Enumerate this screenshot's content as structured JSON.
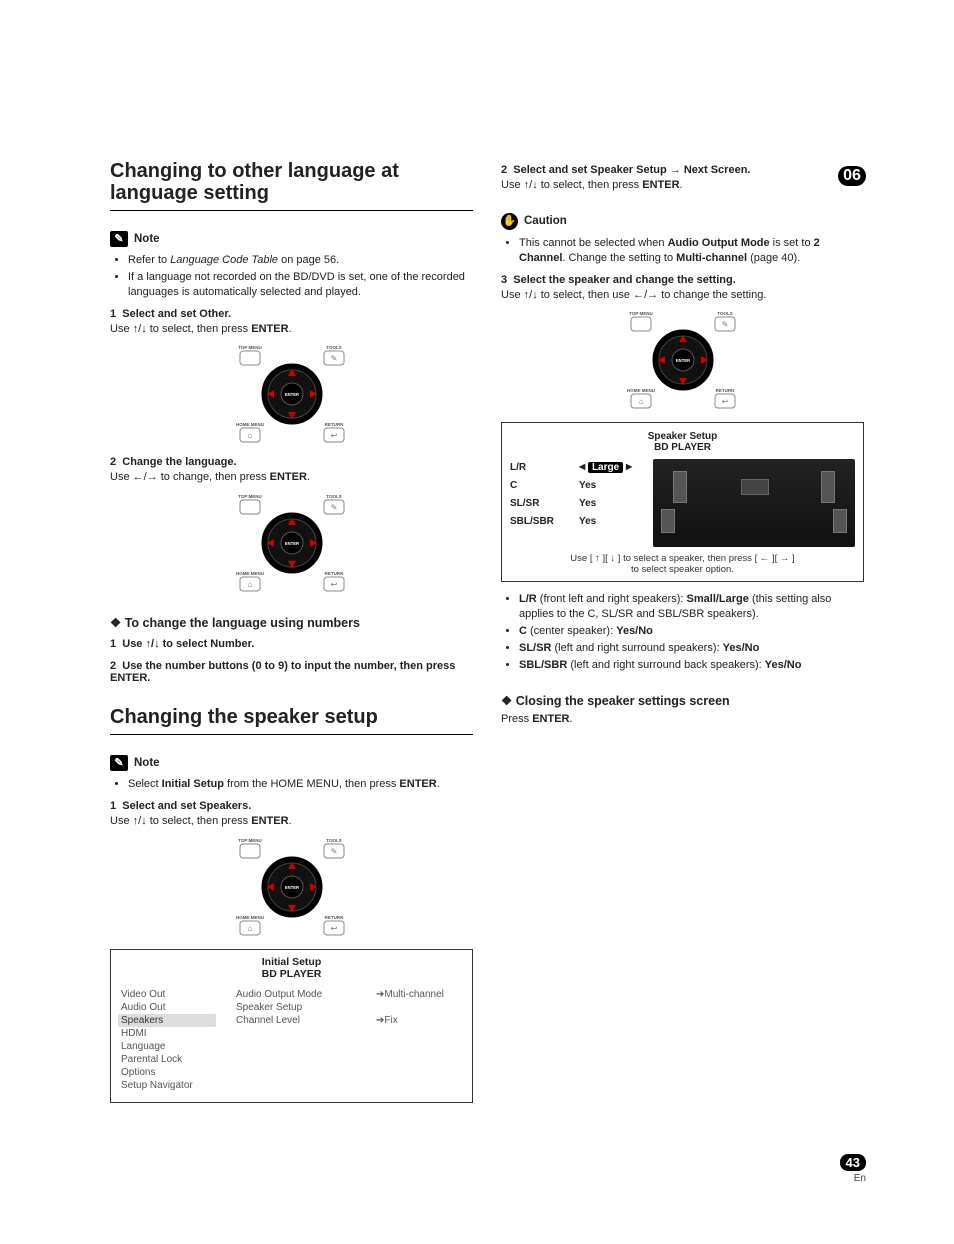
{
  "chapterBadge": "06",
  "pageNumber": "43",
  "pageLang": "En",
  "left": {
    "h1a": "Changing to other language at language setting",
    "noteLabel": "Note",
    "noteItems": [
      {
        "pre": "Refer to ",
        "em": "Language Code Table",
        "post": " on page 56."
      },
      {
        "pre": "If a language not recorded on the BD/DVD is set, one of the recorded languages is automatically selected and played.",
        "em": "",
        "post": ""
      }
    ],
    "step1no": "1",
    "step1": "Select and set Other.",
    "step1text_a": "Use ",
    "step1text_b": " to select, then press ",
    "step1text_enter": "ENTER",
    "step1text_c": ".",
    "step2no": "2",
    "step2": "Change the language.",
    "step2text_a": "Use ",
    "step2text_b": " to change, then press ",
    "step2text_enter": "ENTER",
    "step2text_c": ".",
    "sub1": "To change the language using numbers",
    "sub1_step1no": "1",
    "sub1_step1": "Use ",
    "sub1_step1b": " to select Number.",
    "sub1_step2no": "2",
    "sub1_step2": "Use the number buttons (0 to 9) to input the number, then press ENTER.",
    "h1b": "Changing the speaker setup",
    "noteLabel2": "Note",
    "note2_a": "Select ",
    "note2_b": "Initial Setup",
    "note2_c": " from the HOME MENU, then press ",
    "note2_enter": "ENTER",
    "note2_d": ".",
    "spk_step1no": "1",
    "spk_step1": "Select and set Speakers.",
    "spk_step1text_a": "Use ",
    "spk_step1text_b": " to select, then press ",
    "spk_step1text_enter": "ENTER",
    "spk_step1text_c": ".",
    "menu": {
      "title": "Initial Setup",
      "subtitle": "BD PLAYER",
      "leftItems": [
        "Video Out",
        "Audio Out",
        "Speakers",
        "HDMI",
        "Language",
        "Parental Lock",
        "Options",
        "Setup Navigator"
      ],
      "midItems": [
        "Audio Output Mode",
        "Speaker Setup",
        "Channel Level"
      ],
      "rightItems": [
        "Multi-channel",
        "",
        "Fix"
      ]
    }
  },
  "right": {
    "step2no": "2",
    "step2a": "Select and set Speaker Setup ",
    "step2b": " Next Screen.",
    "step2text_a": "Use ",
    "step2text_b": " to select, then press ",
    "step2text_enter": "ENTER",
    "step2text_c": ".",
    "cautionLabel": "Caution",
    "cautionText_a": "This cannot be selected when ",
    "cautionText_b": "Audio Output Mode",
    "cautionText_c": " is set to ",
    "cautionText_d": "2 Channel",
    "cautionText_e": ". Change the setting to ",
    "cautionText_f": "Multi-channel",
    "cautionText_g": " (page 40).",
    "step3no": "3",
    "step3": "Select the speaker and change the setting.",
    "step3text_a": "Use ",
    "step3text_b": " to select, then use ",
    "step3text_c": " to change the setting.",
    "ss": {
      "title": "Speaker Setup",
      "subtitle": "BD PLAYER",
      "labels": [
        "L/R",
        "C",
        "SL/SR",
        "SBL/SBR"
      ],
      "vals": [
        "Large",
        "Yes",
        "Yes",
        "Yes"
      ],
      "footer_a": "Use [  ",
      "footer_b": "  ][  ",
      "footer_c": "  ] to select a speaker, then press [  ",
      "footer_d": "  ][  ",
      "footer_e": "  ]",
      "footer2": "to select speaker option."
    },
    "descItems": [
      {
        "label": "L/R",
        "mid": " (front left and right speakers): ",
        "opts": "Small/Large",
        "tail": " (this setting also applies to the C, SL/SR and SBL/SBR speakers)."
      },
      {
        "label": "C",
        "mid": " (center speaker): ",
        "opts": "Yes/No",
        "tail": ""
      },
      {
        "label": "SL/SR",
        "mid": " (left and right surround speakers): ",
        "opts": "Yes/No",
        "tail": ""
      },
      {
        "label": "SBL/SBR",
        "mid": " (left and right surround back speakers): ",
        "opts": "Yes/No",
        "tail": ""
      }
    ],
    "sub2": "Closing the speaker settings screen",
    "sub2text_a": "Press ",
    "sub2text_enter": "ENTER",
    "sub2text_b": "."
  },
  "remoteLabels": {
    "topmenu": "TOP MENU",
    "tools": "TOOLS",
    "homemenu": "HOME MENU",
    "return": "RETURN",
    "enter": "ENTER"
  }
}
